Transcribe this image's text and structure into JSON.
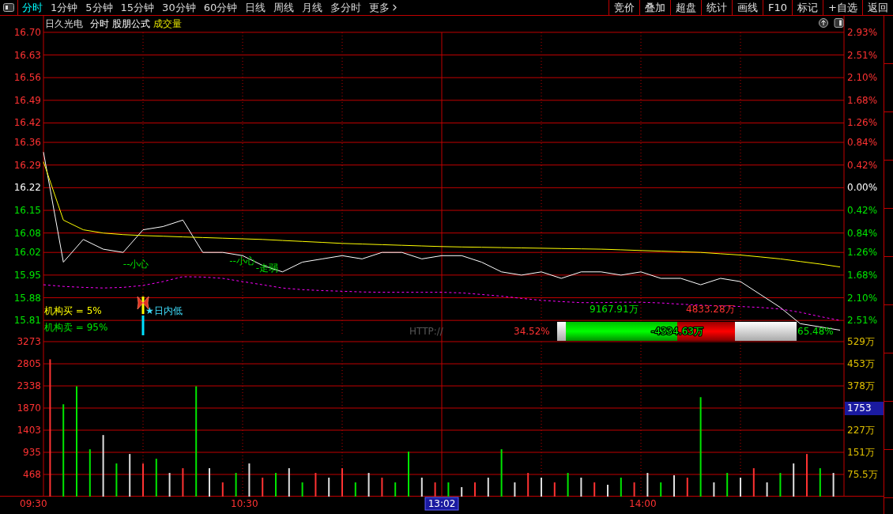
{
  "toolbar": {
    "tabs": [
      {
        "label": "分时",
        "selected": true
      },
      {
        "label": "1分钟",
        "selected": false
      },
      {
        "label": "5分钟",
        "selected": false
      },
      {
        "label": "15分钟",
        "selected": false
      },
      {
        "label": "30分钟",
        "selected": false
      },
      {
        "label": "60分钟",
        "selected": false
      },
      {
        "label": "日线",
        "selected": false
      },
      {
        "label": "周线",
        "selected": false
      },
      {
        "label": "月线",
        "selected": false
      },
      {
        "label": "多分时",
        "selected": false
      },
      {
        "label": "更多",
        "selected": false
      }
    ],
    "buttons": [
      "竞价",
      "叠加",
      "超盘",
      "统计",
      "画线",
      "F10",
      "标记",
      "+自选",
      "返回"
    ]
  },
  "header": {
    "stock": "日久光电",
    "mode": "分时",
    "formula": "股朋公式",
    "indicator": "成交量"
  },
  "price_chart": {
    "chart_data": {
      "type": "line",
      "categories": [
        null,
        null,
        null,
        null,
        null,
        null,
        null,
        null,
        null,
        null,
        null,
        null,
        null,
        null,
        null,
        null,
        null,
        null,
        null,
        null,
        null,
        null,
        null,
        null,
        null,
        null,
        null,
        null,
        null,
        null,
        null,
        null,
        null,
        null,
        null,
        null,
        null,
        null,
        null,
        null,
        null
      ],
      "ylim": [
        15.764,
        16.751
      ],
      "grid": true,
      "yticks": [
        {
          "value": 16.7,
          "label": "16.70"
        },
        {
          "value": 16.63,
          "label": "16.63"
        },
        {
          "value": 16.56,
          "label": "16.56"
        },
        {
          "value": 16.49,
          "label": "16.49"
        },
        {
          "value": 16.42,
          "label": "16.42"
        },
        {
          "value": 16.36,
          "label": "16.36"
        },
        {
          "value": 16.29,
          "label": "16.29"
        },
        {
          "value": 16.22,
          "label": "16.22"
        },
        {
          "value": 16.15,
          "label": "16.15"
        },
        {
          "value": 16.08,
          "label": "16.08"
        },
        {
          "value": 16.02,
          "label": "16.02"
        },
        {
          "value": 15.95,
          "label": "15.95"
        },
        {
          "value": 15.88,
          "label": "15.88"
        },
        {
          "value": 15.81,
          "label": "15.81"
        }
      ],
      "series": [
        {
          "color": "#ffffff",
          "values": [
            16.33,
            15.99,
            16.06,
            16.03,
            16.02,
            16.09,
            16.1,
            16.12,
            16.02,
            16.02,
            16.01,
            15.98,
            15.96,
            15.99,
            16.0,
            16.01,
            16.0,
            16.02,
            16.02,
            16.0,
            16.01,
            16.01,
            15.99,
            15.96,
            15.95,
            15.96,
            15.94,
            15.96,
            15.96,
            15.95,
            15.96,
            15.94,
            15.94,
            15.92,
            15.94,
            15.93,
            15.89,
            15.85,
            15.8,
            15.79,
            15.78
          ]
        },
        {
          "color": "#ffff00",
          "values": [
            16.3,
            16.12,
            16.09,
            16.08,
            16.075,
            16.072,
            16.07,
            16.068,
            16.066,
            16.064,
            16.062,
            16.06,
            16.057,
            16.054,
            16.051,
            16.048,
            16.046,
            16.044,
            16.042,
            16.04,
            16.038,
            16.037,
            16.036,
            16.035,
            16.034,
            16.033,
            16.032,
            16.031,
            16.03,
            16.028,
            16.026,
            16.024,
            16.022,
            16.02,
            16.016,
            16.012,
            16.006,
            16.0,
            15.992,
            15.984,
            15.975
          ]
        },
        {
          "color": "#ff00ff",
          "line_style": "dashed",
          "values": [
            15.92,
            15.915,
            15.912,
            15.91,
            15.912,
            15.918,
            15.93,
            15.945,
            15.944,
            15.94,
            15.93,
            15.92,
            15.91,
            15.905,
            15.902,
            15.9,
            15.898,
            15.897,
            15.897,
            15.897,
            15.897,
            15.895,
            15.89,
            15.885,
            15.878,
            15.872,
            15.868,
            15.865,
            15.865,
            15.866,
            15.866,
            15.864,
            15.86,
            15.857,
            15.855,
            15.853,
            15.85,
            15.845,
            15.835,
            15.822,
            15.81
          ]
        }
      ]
    },
    "signals": [
      "--小心",
      "--小心",
      "-走弱"
    ],
    "percent_axis": [
      {
        "label": "2.93%",
        "kind": "up"
      },
      {
        "label": "2.51%",
        "kind": "up"
      },
      {
        "label": "2.10%",
        "kind": "up"
      },
      {
        "label": "1.68%",
        "kind": "up"
      },
      {
        "label": "1.26%",
        "kind": "up"
      },
      {
        "label": "0.84%",
        "kind": "up"
      },
      {
        "label": "0.42%",
        "kind": "up"
      },
      {
        "label": "0.00%",
        "kind": "flat"
      },
      {
        "label": "0.42%",
        "kind": "down"
      },
      {
        "label": "0.84%",
        "kind": "down"
      },
      {
        "label": "1.26%",
        "kind": "down"
      },
      {
        "label": "1.68%",
        "kind": "down"
      },
      {
        "label": "2.10%",
        "kind": "down"
      },
      {
        "label": "2.51%",
        "kind": "down"
      }
    ],
    "institution": {
      "buy": "机构买 = 5%",
      "sell": "机构卖 = 95%",
      "low_marker": "★日内低"
    },
    "flow": {
      "source": "HTTP://",
      "inflow_ratio": "34.52%",
      "inflow": "9167.91万",
      "outflow": "4833.28万",
      "net": "-4334.63万",
      "outflow_ratio": "65.48%"
    }
  },
  "volume_chart": {
    "chart_data": {
      "type": "bar",
      "categories": [
        null,
        null,
        null,
        null,
        null,
        null,
        null,
        null,
        null,
        null,
        null,
        null,
        null,
        null,
        null,
        null,
        null,
        null,
        null,
        null,
        null,
        null,
        null,
        null,
        null,
        null,
        null,
        null,
        null,
        null,
        null,
        null,
        null,
        null,
        null,
        null,
        null,
        null,
        null,
        null,
        null,
        null,
        null,
        null,
        null,
        null,
        null,
        null,
        null,
        null,
        null,
        null,
        null,
        null,
        null,
        null,
        null,
        null,
        null,
        null
      ],
      "ylim": [
        0,
        3407
      ],
      "grid": true,
      "yticks": [
        {
          "value": 3273,
          "label": "3273"
        },
        {
          "value": 2805,
          "label": "2805"
        },
        {
          "value": 2338,
          "label": "2338"
        },
        {
          "value": 1870,
          "label": "1870"
        },
        {
          "value": 1403,
          "label": "1403"
        },
        {
          "value": 935,
          "label": "935"
        },
        {
          "value": 468,
          "label": "468"
        }
      ],
      "values": [
        2900,
        1950,
        2330,
        1000,
        1300,
        700,
        900,
        700,
        800,
        500,
        600,
        2330,
        600,
        300,
        500,
        700,
        400,
        500,
        600,
        300,
        500,
        400,
        600,
        300,
        500,
        400,
        300,
        950,
        400,
        300,
        300,
        200,
        300,
        400,
        1000,
        300,
        500,
        400,
        300,
        500,
        400,
        300,
        250,
        400,
        300,
        500,
        300,
        450,
        400,
        2100,
        300,
        500,
        400,
        600,
        300,
        500,
        700,
        900,
        600,
        500
      ]
    },
    "bars": [
      {
        "kind": "up"
      },
      {
        "kind": "down"
      },
      {
        "kind": "down"
      },
      {
        "kind": "down"
      },
      {
        "kind": "flat"
      },
      {
        "kind": "down"
      },
      {
        "kind": "flat"
      },
      {
        "kind": "up"
      },
      {
        "kind": "down"
      },
      {
        "kind": "flat"
      },
      {
        "kind": "up"
      },
      {
        "kind": "down"
      },
      {
        "kind": "flat"
      },
      {
        "kind": "up"
      },
      {
        "kind": "down"
      },
      {
        "kind": "flat"
      },
      {
        "kind": "up"
      },
      {
        "kind": "down"
      },
      {
        "kind": "flat"
      },
      {
        "kind": "down"
      },
      {
        "kind": "up"
      },
      {
        "kind": "flat"
      },
      {
        "kind": "up"
      },
      {
        "kind": "down"
      },
      {
        "kind": "flat"
      },
      {
        "kind": "up"
      },
      {
        "kind": "down"
      },
      {
        "kind": "down"
      },
      {
        "kind": "flat"
      },
      {
        "kind": "up"
      },
      {
        "kind": "down"
      },
      {
        "kind": "flat"
      },
      {
        "kind": "up"
      },
      {
        "kind": "flat"
      },
      {
        "kind": "down"
      },
      {
        "kind": "flat"
      },
      {
        "kind": "up"
      },
      {
        "kind": "flat"
      },
      {
        "kind": "up"
      },
      {
        "kind": "down"
      },
      {
        "kind": "flat"
      },
      {
        "kind": "up"
      },
      {
        "kind": "flat"
      },
      {
        "kind": "down"
      },
      {
        "kind": "up"
      },
      {
        "kind": "flat"
      },
      {
        "kind": "down"
      },
      {
        "kind": "flat"
      },
      {
        "kind": "up"
      },
      {
        "kind": "down"
      },
      {
        "kind": "flat"
      },
      {
        "kind": "down"
      },
      {
        "kind": "flat"
      },
      {
        "kind": "up"
      },
      {
        "kind": "flat"
      },
      {
        "kind": "down"
      },
      {
        "kind": "flat"
      },
      {
        "kind": "up"
      },
      {
        "kind": "down"
      },
      {
        "kind": "flat"
      }
    ],
    "right_axis": [
      "529万",
      "453万",
      "378万",
      "227万",
      "151万",
      "75.5万"
    ],
    "crosshair_volume": "1753"
  },
  "time_axis": [
    "09:30",
    "10:30",
    "14:00"
  ],
  "crosshair_time": "13:02"
}
